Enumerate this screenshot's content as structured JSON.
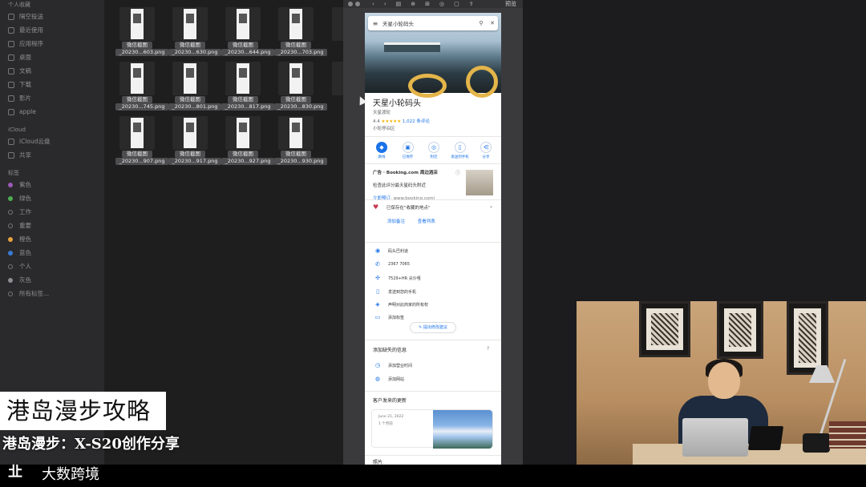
{
  "finder_sidebar": {
    "favorites_header": "个人收藏",
    "favorites": [
      "隔空投送",
      "最近使用",
      "应用程序",
      "桌面",
      "文稿",
      "下载",
      "影片",
      "apple"
    ],
    "icloud_header": "iCloud",
    "icloud": [
      "iCloud云盘",
      "共享"
    ],
    "tags_header": "标签",
    "tags": [
      {
        "label": "紫色",
        "color": "#9b59b6"
      },
      {
        "label": "绿色",
        "color": "#4caf50"
      },
      {
        "label": "工作",
        "color": "transparent"
      },
      {
        "label": "重要",
        "color": "transparent"
      },
      {
        "label": "橙色",
        "color": "#e6a23c"
      },
      {
        "label": "蓝色",
        "color": "#3a7bd5"
      },
      {
        "label": "个人",
        "color": "transparent"
      },
      {
        "label": "灰色",
        "color": "#8e8e93"
      },
      {
        "label": "所有标签...",
        "color": "transparent"
      }
    ]
  },
  "finder_files": [
    {
      "tag": "微信截图",
      "name": "_20230...603.png"
    },
    {
      "tag": "微信截图",
      "name": "_20230...630.png"
    },
    {
      "tag": "微信截图",
      "name": "_20230...644.png"
    },
    {
      "tag": "微信截图",
      "name": "_20230...703.png"
    },
    {
      "tag": "微信截图",
      "name": "_20230...745.png"
    },
    {
      "tag": "微信截图",
      "name": "_20230...801.png"
    },
    {
      "tag": "微信截图",
      "name": "_20230...817.png"
    },
    {
      "tag": "微信截图",
      "name": "_20230...830.png"
    },
    {
      "tag": "微信截图",
      "name": "_20230...907.png"
    },
    {
      "tag": "微信截图",
      "name": "_20230...917.png"
    },
    {
      "tag": "微信截图",
      "name": "_20230...927.png"
    },
    {
      "tag": "微信截图",
      "name": "_20230...930.png"
    }
  ],
  "preview": {
    "title": "预览"
  },
  "maps": {
    "search_query": "天星小轮码头",
    "place_name": "天星小轮码头",
    "place_subtitle": "天星渡轮",
    "rating_value": "4.4",
    "rating_stars": "★★★★★",
    "review_count": "1,022 条评论",
    "category": "小轮停泊区",
    "actions": [
      {
        "icon": "◆",
        "label": "路线",
        "filled": true
      },
      {
        "icon": "▣",
        "label": "已保存",
        "filled": false
      },
      {
        "icon": "◎",
        "label": "附近",
        "filled": false
      },
      {
        "icon": "▯",
        "label": "发送到手机",
        "filled": false
      },
      {
        "icon": "⋲",
        "label": "分享",
        "filled": false
      }
    ],
    "ad_header": "广告 · Booking.com 周边酒店",
    "ad_desc": "检查此评分最天星码头附近",
    "ad_link": "立即预订",
    "ad_domain": "· www.booking.com/",
    "saved_text": "已保存在\"收藏的地点\"",
    "saved_links": [
      "添加备注",
      "查看列表"
    ],
    "info_rows": [
      {
        "icon": "◉",
        "text": "码头巴利道"
      },
      {
        "icon": "✆",
        "text": "2367 7065"
      },
      {
        "icon": "✣",
        "text": "7529+HR 尖沙咀"
      },
      {
        "icon": "▯",
        "text": "发送到您的手机"
      },
      {
        "icon": "◈",
        "text": "声明对此商家的所有权"
      },
      {
        "icon": "▭",
        "text": "添加标签"
      }
    ],
    "suggest_button": "✎ 提出修改建议",
    "missing_title": "添加缺失的信息",
    "missing_rows": [
      {
        "icon": "◷",
        "text": "添加营业时间"
      },
      {
        "icon": "◍",
        "text": "添加网站"
      }
    ],
    "updates_title": "客户发来的更新",
    "update_date": "June 21, 2022",
    "update_count": "1 个月前",
    "photos_title": "照片"
  },
  "overlay": {
    "title": "港岛漫步攻略",
    "subtitle": "港岛漫步：X-S20创作分享",
    "logo_mark": "㐀",
    "logo_text": "大数跨境"
  }
}
